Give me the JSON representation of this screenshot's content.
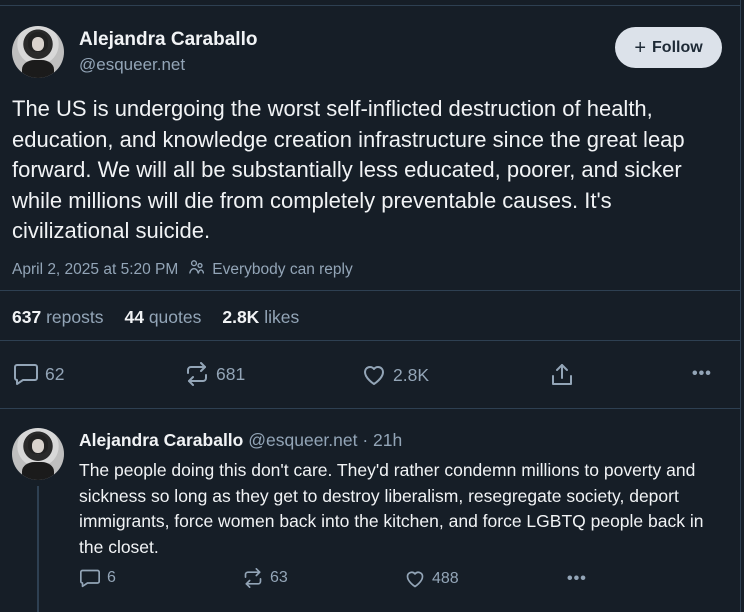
{
  "post": {
    "author": {
      "display_name": "Alejandra Caraballo",
      "handle": "@esqueer.net"
    },
    "follow_button": {
      "icon": "plus-icon",
      "label": "Follow"
    },
    "text": "The US is undergoing the worst self-inflicted destruction of health, education, and knowledge creation infrastructure since the great leap forward. We will all be substantially less educated, poorer, and sicker while millions will die from completely preventable causes. It's civilizational suicide.",
    "timestamp": "April 2, 2025 at 5:20 PM",
    "reply_setting": "Everybody can reply",
    "stats": {
      "reposts_count": "637",
      "reposts_label": "reposts",
      "quotes_count": "44",
      "quotes_label": "quotes",
      "likes_count": "2.8K",
      "likes_label": "likes"
    },
    "actions": {
      "replies": "62",
      "reposts": "681",
      "likes": "2.8K",
      "more": "•••"
    }
  },
  "reply": {
    "author": {
      "display_name": "Alejandra Caraballo",
      "handle": "@esqueer.net",
      "time": "· 21h"
    },
    "text": "The people doing this don't care. They'd rather condemn millions to poverty and sickness so long as they get to destroy liberalism, resegregate society, deport immigrants, force women back into the kitchen, and force LGBTQ people back in the closet.",
    "actions": {
      "replies": "6",
      "reposts": "63",
      "likes": "488",
      "more": "•••"
    }
  },
  "colors": {
    "background": "#161e27",
    "text_primary": "#f1f3f5",
    "text_secondary": "#93a5b7",
    "divider": "#2e4052",
    "follow_button_bg": "#dce2ea"
  }
}
